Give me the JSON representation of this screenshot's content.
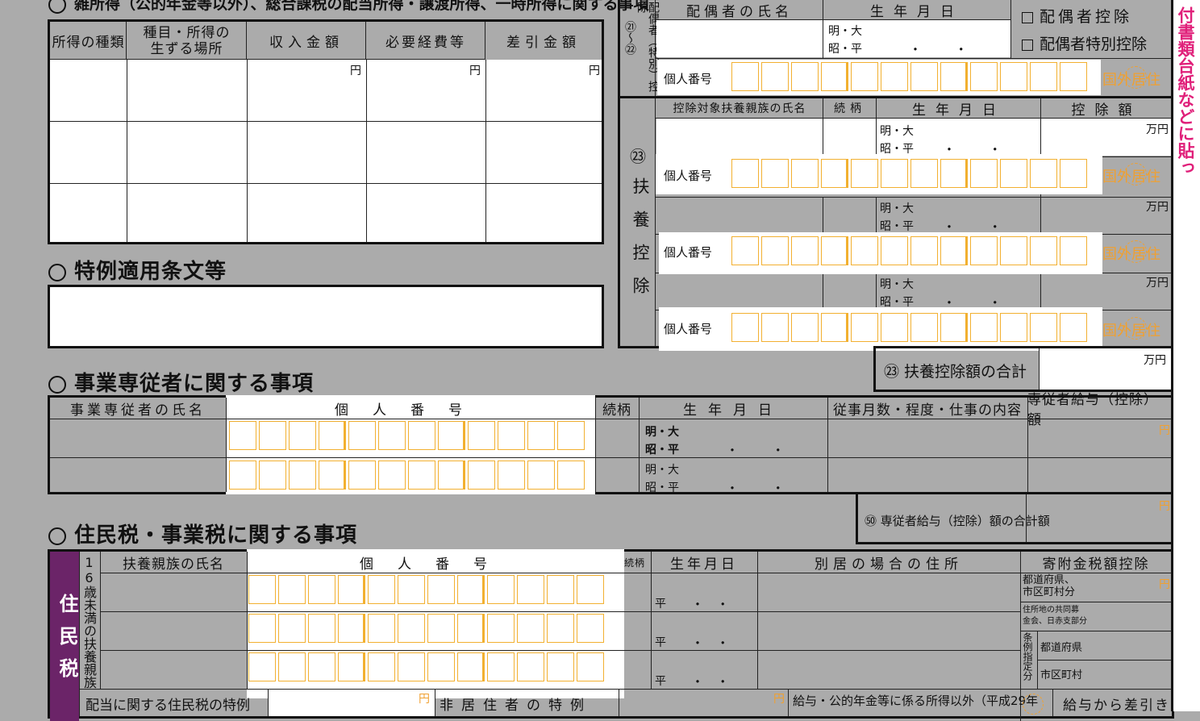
{
  "misc": {
    "header_text": "雑所得（公的年金等以外）、総合課税の配当所得・譲渡所得、一時所得に関する事項",
    "col_kind": "所得の種類",
    "col_place": "種目・所得の\n生ずる場所",
    "col_income": "収入金額",
    "col_expense": "必要経費等",
    "col_diff": "差引金額",
    "yen": "円"
  },
  "special": {
    "title": "特例適用条文等"
  },
  "spouse": {
    "vertical_label": "配偶者（特別）控除",
    "num_label": "㉑〜㉒",
    "col_name": "配偶者の氏名",
    "col_birth": "生年月日",
    "era1": "明・大",
    "era2": "昭・平",
    "check1": "配偶者控除",
    "check2": "配偶者特別控除",
    "mynumber": "個人番号",
    "kokugai": "国外居住"
  },
  "dependents": {
    "num": "㉓",
    "vertical_label": "扶養控除",
    "col_name": "控除対象扶養親族の氏名",
    "col_rel": "続柄",
    "col_birth": "生年月日",
    "col_amount": "控除額",
    "era1": "明・大",
    "era2": "昭・平",
    "man_yen": "万円",
    "mynumber": "個人番号",
    "kokugai": "国外居住",
    "total_label": "㉓ 扶養控除額の合計"
  },
  "employees": {
    "title": "事業専従者に関する事項",
    "col_name": "事業専従者の氏名",
    "col_number": "個人番号",
    "col_rel": "続柄",
    "col_birth": "生年月日",
    "col_work": "従事月数・程度・仕事の内容",
    "col_salary": "専従者給与（控除）額",
    "era1": "明・大",
    "era2": "昭・平",
    "yen": "円",
    "total_label": "㊿ 専従者給与（控除）額の合計額"
  },
  "resident": {
    "title": "住民税・事業税に関する事項",
    "side_label": "住民税",
    "under16": "16歳未満の扶養親族",
    "col_name": "扶養親族の氏名",
    "col_number": "個人番号",
    "col_rel": "続柄",
    "col_birth": "生年月日",
    "col_address": "別居の場合の住所",
    "col_donation": "寄附金税額控除",
    "era": "平",
    "don1": "都道府県、\n市区町村分",
    "don2": "住所地の共同募\n金会、日赤支部分",
    "don3_side": "条例指定分",
    "don3a": "都道府県",
    "don3b": "市区町村",
    "yen": "円",
    "bottom1": "配当に関する住民税の特例",
    "bottom2": "非居住者の特例",
    "bottom3": "給与・公的年金等に係る所得以外（平成29年",
    "bottom4": "給与から差引き"
  },
  "sidebar": {
    "text": "、国民年金保険料や生命保険料の支払証明書など申告書に添付しなければならない書類は添付書類台紙などに貼っ"
  }
}
